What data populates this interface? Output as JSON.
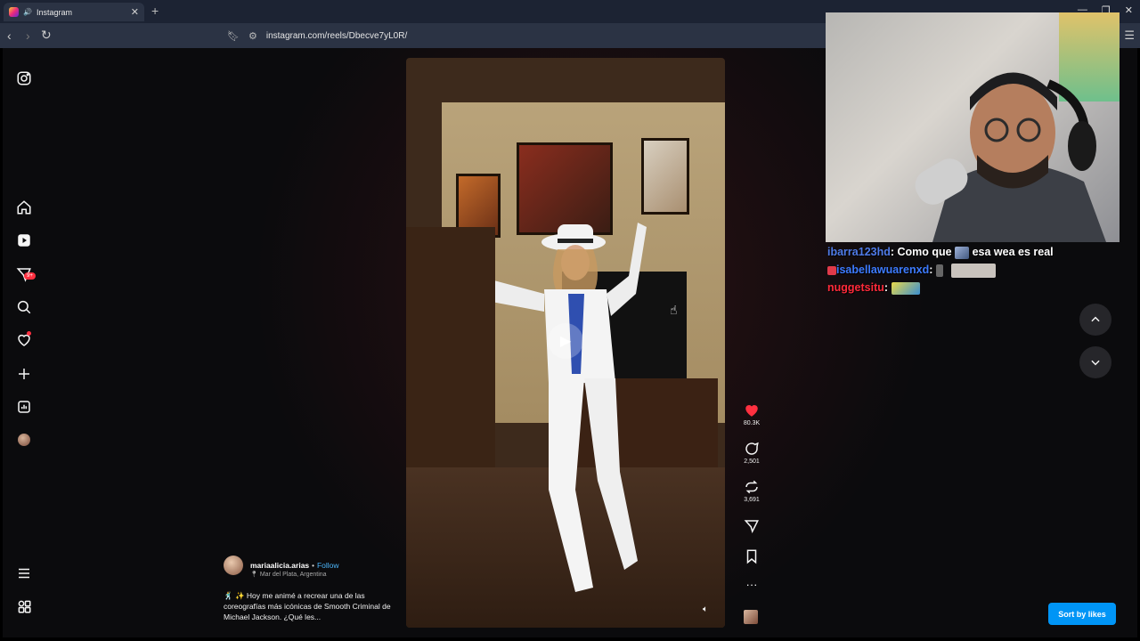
{
  "browser": {
    "tab_title": "Instagram",
    "new_tab": "+",
    "url": "instagram.com/reels/Dbecve7yL0R/",
    "win_controls": [
      "—",
      "❐",
      "✕"
    ]
  },
  "sidebar": {
    "notifications_badge": "9+"
  },
  "reel": {
    "likes": "80.3K",
    "comments": "2,501",
    "reposts": "3,691",
    "author": "mariaalicia.arias",
    "follow": "Follow",
    "separator": "•",
    "location": "Mar del Plata, Argentina",
    "caption": "🕺 ✨ Hoy me animé a recrear una de las coreografías más icónicas de Smooth Criminal de Michael Jackson. ¿Qué les..."
  },
  "controls": {
    "sort_button": "Sort by likes"
  },
  "chat": [
    {
      "user": "ibarra123hd",
      "message": "Como que",
      "message2": "esa wea es real"
    },
    {
      "user": "isabellawuarenxd",
      "message": ""
    },
    {
      "user": "nuggetsitu",
      "message": ""
    }
  ],
  "colors": {
    "accent_blue": "#0095f6",
    "like_red": "#ff3040",
    "chrome_bg": "#1c2333"
  }
}
